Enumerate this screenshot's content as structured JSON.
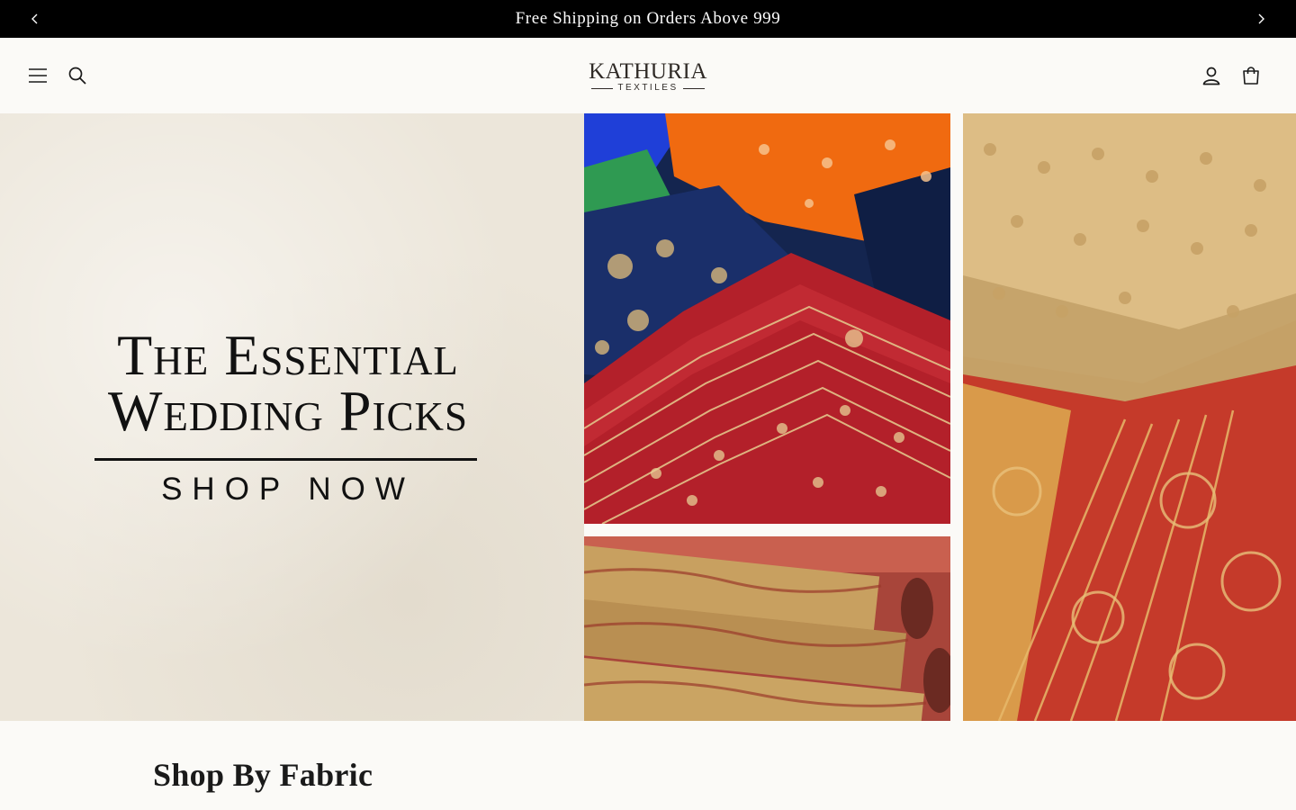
{
  "announcement": {
    "text": "Free Shipping on Orders Above 999",
    "prev_icon": "chevron-left",
    "next_icon": "chevron-right"
  },
  "header": {
    "menu_icon": "hamburger-menu",
    "search_icon": "search",
    "logo": {
      "main": "KATHURIA",
      "sub": "TEXTILES"
    },
    "account_icon": "user",
    "cart_icon": "shopping-bag"
  },
  "hero": {
    "title_line1": "The Essential",
    "title_line2": "Wedding Picks",
    "cta": "SHOP NOW"
  },
  "sections": {
    "shop_by_fabric": "Shop By Fabric"
  },
  "colors": {
    "announcement_bg": "#000000",
    "page_bg": "#fbfaf7",
    "hero_panel_bg": "#ece6da",
    "text": "#111111",
    "fabric_red": "#b3202a",
    "fabric_gold": "#d9b77c",
    "fabric_orange": "#f06a10",
    "fabric_navy": "#142a5c"
  }
}
